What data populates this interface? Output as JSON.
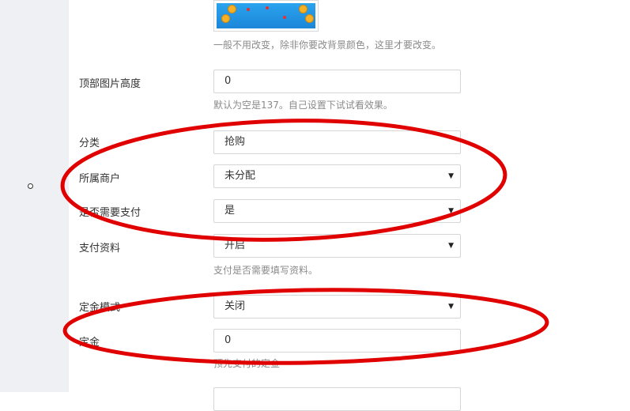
{
  "thumb_help": "一般不用改变，除非你要改背景颜色，这里才要改变。",
  "fields": {
    "top_image_height": {
      "label": "顶部图片高度",
      "value": "0",
      "help": "默认为空是137。自己设置下试试看效果。"
    },
    "category": {
      "label": "分类",
      "value": "抢购"
    },
    "merchant": {
      "label": "所属商户",
      "value": "未分配"
    },
    "need_payment": {
      "label": "是否需要支付",
      "value": "是"
    },
    "payment_info": {
      "label": "支付资料",
      "value": "开启",
      "help": "支付是否需要填写资料。"
    },
    "deposit_mode": {
      "label": "定金模式",
      "value": "关闭"
    },
    "deposit": {
      "label": "定金",
      "value": "0",
      "help": "预先支付的定金"
    }
  },
  "icons": {
    "dropdown": "caret-down-icon",
    "bullet": "circle-bullet-icon"
  },
  "annotation_color": "#e00000"
}
